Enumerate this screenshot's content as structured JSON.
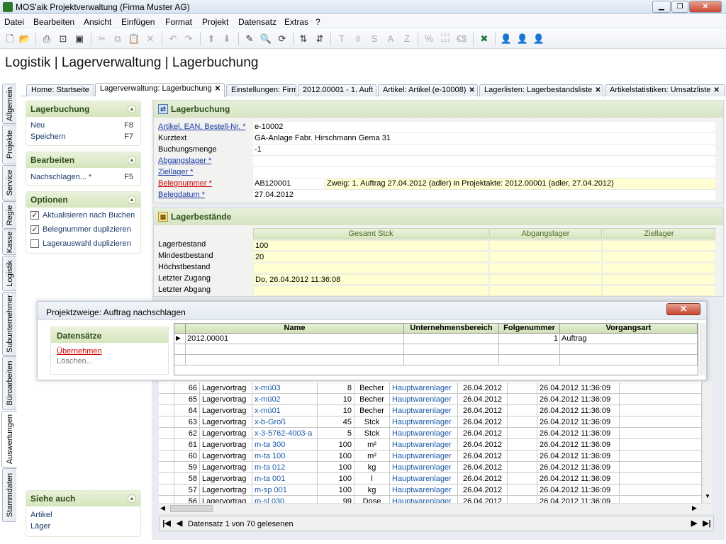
{
  "window": {
    "title": "MOS'aik Projektverwaltung (Firma Muster AG)"
  },
  "menu": [
    "Datei",
    "Bearbeiten",
    "Ansicht",
    "Einfügen",
    "Format",
    "Projekt",
    "Datensatz",
    "Extras",
    "?"
  ],
  "toolbar": {
    "text_icons": [
      "T",
      "#",
      "S",
      "A",
      "Z",
      "%",
      "1.1.1 1.1.2",
      "€$"
    ]
  },
  "page_title": "Logistik | Lagerverwaltung | Lagerbuchung",
  "vertical_tabs": [
    "Allgemein",
    "Projekte",
    "Service",
    "Regie",
    "Kasse",
    "Logistik",
    "Subunternehmer",
    "Büroarbeiten",
    "Auswertungen",
    "Stammdaten"
  ],
  "tabs": [
    {
      "label": "Home: Startseite"
    },
    {
      "label": "Lagerverwaltung: Lagerbuchung"
    },
    {
      "label": "Einstellungen: Firm"
    },
    {
      "label": "2012.00001 - 1. Auft"
    },
    {
      "label": "Artikel: Artikel (e-10008)"
    },
    {
      "label": "Lagerlisten: Lagerbestandsliste"
    },
    {
      "label": "Artikelstatistiken: Umsatzliste"
    }
  ],
  "left": {
    "lagerbuchung": {
      "title": "Lagerbuchung",
      "items": [
        {
          "label": "Neu",
          "key": "F8"
        },
        {
          "label": "Speichern",
          "key": "F7"
        }
      ]
    },
    "bearbeiten": {
      "title": "Bearbeiten",
      "items": [
        {
          "label": "Nachschlagen... *",
          "key": "F5"
        }
      ]
    },
    "optionen": {
      "title": "Optionen",
      "items": [
        {
          "label": "Aktualisieren nach Buchen",
          "checked": true
        },
        {
          "label": "Belegnummer duplizieren",
          "checked": true
        },
        {
          "label": "Lagerauswahl duplizieren",
          "checked": false
        }
      ]
    },
    "siehe_auch": {
      "title": "Siehe auch",
      "items": [
        "Artikel",
        "Läger"
      ]
    }
  },
  "form": {
    "title": "Lagerbuchung",
    "artikel": {
      "label": "Artikel, EAN, Bestell-Nr. *",
      "value": "e-10002"
    },
    "kurztext": {
      "label": "Kurztext",
      "value": "GA-Anlage Fabr. Hirschmann Gema 31"
    },
    "menge": {
      "label": "Buchungsmenge",
      "value": "-1"
    },
    "abgangslager": {
      "label": "Abgangslager *",
      "value": ""
    },
    "ziellager": {
      "label": "Ziellager *",
      "value": ""
    },
    "belegnummer": {
      "label": "Belegnummer *",
      "value": "AB120001",
      "info": "Zweig: 1. Auftrag 27.04.2012 (adler) in Projektakte: 2012.00001 (adler, 27.04.2012)"
    },
    "belegdatum": {
      "label": "Belegdatum *",
      "value": "27.04.2012"
    }
  },
  "bestaende": {
    "title": "Lagerbestände",
    "headers": [
      "Gesamt Stck",
      "Abgangslager",
      "Ziellager"
    ],
    "rows": [
      {
        "label": "Lagerbestand",
        "value": "100"
      },
      {
        "label": "Mindestbestand",
        "value": "20"
      },
      {
        "label": "Höchstbestand",
        "value": ""
      },
      {
        "label": "Letzter Zugang",
        "value": "Do, 26.04.2012 11:36:08"
      },
      {
        "label": "Letzter Abgang",
        "value": ""
      }
    ]
  },
  "popup": {
    "title": "Projektzweige: Auftrag nachschlagen",
    "section": "Datensätze",
    "actions": [
      "Übernehmen",
      "Löschen..."
    ],
    "columns": [
      "Name",
      "Unternehmensbereich",
      "Folgenummer",
      "Vorgangsart"
    ],
    "row": {
      "name": "2012.00001",
      "bereich": "",
      "folge": "1",
      "art": "Auftrag"
    }
  },
  "buchungen": [
    {
      "nr": "66",
      "typ": "Lagervortrag",
      "artikel": "x-mü03",
      "menge": "8",
      "einheit": "Becher",
      "lager": "Hauptwarenlager",
      "datum": "26.04.2012",
      "zeit": "26.04.2012 11:36:09"
    },
    {
      "nr": "65",
      "typ": "Lagervortrag",
      "artikel": "x-mü02",
      "menge": "10",
      "einheit": "Becher",
      "lager": "Hauptwarenlager",
      "datum": "26.04.2012",
      "zeit": "26.04.2012 11:36:09"
    },
    {
      "nr": "64",
      "typ": "Lagervortrag",
      "artikel": "x-mü01",
      "menge": "10",
      "einheit": "Becher",
      "lager": "Hauptwarenlager",
      "datum": "26.04.2012",
      "zeit": "26.04.2012 11:36:09"
    },
    {
      "nr": "63",
      "typ": "Lagervortrag",
      "artikel": "x-b-Groß",
      "menge": "45",
      "einheit": "Stck",
      "lager": "Hauptwarenlager",
      "datum": "26.04.2012",
      "zeit": "26.04.2012 11:36:09"
    },
    {
      "nr": "62",
      "typ": "Lagervortrag",
      "artikel": "x-3-5762-4003-a",
      "menge": "5",
      "einheit": "Stck",
      "lager": "Hauptwarenlager",
      "datum": "26.04.2012",
      "zeit": "26.04.2012 11:36:09"
    },
    {
      "nr": "61",
      "typ": "Lagervortrag",
      "artikel": "m-ta 300",
      "menge": "100",
      "einheit": "m²",
      "lager": "Hauptwarenlager",
      "datum": "26.04.2012",
      "zeit": "26.04.2012 11:36:09"
    },
    {
      "nr": "60",
      "typ": "Lagervortrag",
      "artikel": "m-ta 100",
      "menge": "100",
      "einheit": "m²",
      "lager": "Hauptwarenlager",
      "datum": "26.04.2012",
      "zeit": "26.04.2012 11:36:09"
    },
    {
      "nr": "59",
      "typ": "Lagervortrag",
      "artikel": "m-ta 012",
      "menge": "100",
      "einheit": "kg",
      "lager": "Hauptwarenlager",
      "datum": "26.04.2012",
      "zeit": "26.04.2012 11:36:09"
    },
    {
      "nr": "58",
      "typ": "Lagervortrag",
      "artikel": "m-ta 001",
      "menge": "100",
      "einheit": "l",
      "lager": "Hauptwarenlager",
      "datum": "26.04.2012",
      "zeit": "26.04.2012 11:36:09"
    },
    {
      "nr": "57",
      "typ": "Lagervortrag",
      "artikel": "m-sp 001",
      "menge": "100",
      "einheit": "kg",
      "lager": "Hauptwarenlager",
      "datum": "26.04.2012",
      "zeit": "26.04.2012 11:36:09"
    },
    {
      "nr": "56",
      "typ": "Lagervortrag",
      "artikel": "m-sl 030",
      "menge": "99",
      "einheit": "Dose",
      "lager": "Hauptwarenlager",
      "datum": "26.04.2012",
      "zeit": "26.04.2012 11:36:09"
    }
  ],
  "navigator": {
    "text": "Datensatz 1 von 70 gelesenen"
  },
  "colors": {
    "accent_green": "#d5e5bd",
    "field_yellow": "#ffffd2",
    "link_blue": "#1a3aa8",
    "required_red": "#cc0000"
  }
}
